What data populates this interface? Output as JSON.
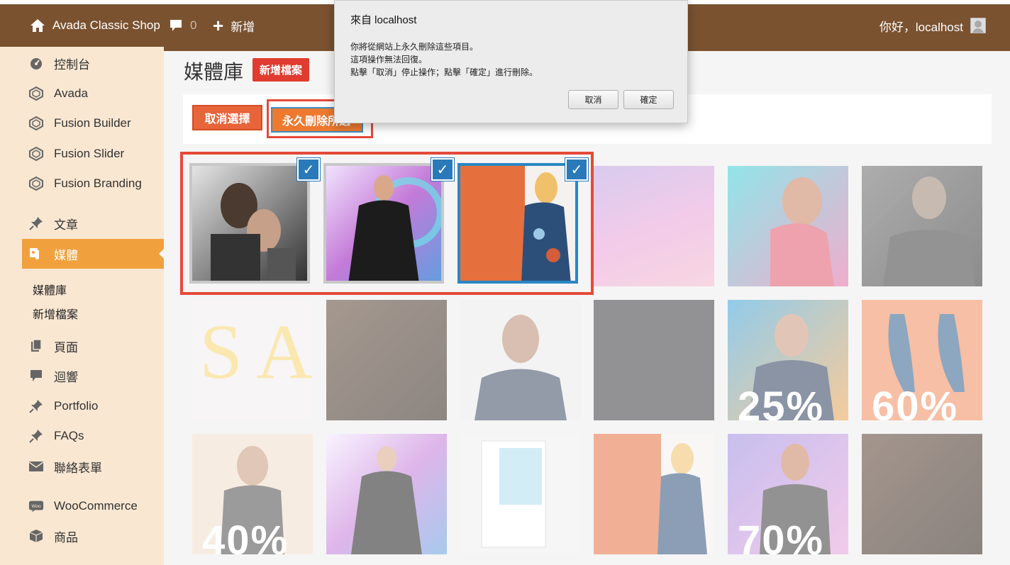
{
  "adminbar": {
    "site_name": "Avada Classic Shop",
    "comments_count": "0",
    "new_label": "新增",
    "greeting": "你好，localhost"
  },
  "sidebar": {
    "items": [
      {
        "label": "控制台",
        "icon": "dashboard-icon"
      },
      {
        "label": "Avada",
        "icon": "avada-icon"
      },
      {
        "label": "Fusion Builder",
        "icon": "fusion-builder-icon"
      },
      {
        "label": "Fusion Slider",
        "icon": "fusion-slider-icon"
      },
      {
        "label": "Fusion Branding",
        "icon": "fusion-branding-icon"
      },
      {
        "label": "文章",
        "icon": "pin-icon"
      },
      {
        "label": "媒體",
        "icon": "media-icon"
      },
      {
        "label": "頁面",
        "icon": "pages-icon"
      },
      {
        "label": "迴響",
        "icon": "comment-icon"
      },
      {
        "label": "Portfolio",
        "icon": "pin-icon"
      },
      {
        "label": "FAQs",
        "icon": "pin-icon"
      },
      {
        "label": "聯絡表單",
        "icon": "mail-icon"
      },
      {
        "label": "WooCommerce",
        "icon": "woocommerce-icon"
      },
      {
        "label": "商品",
        "icon": "box-icon"
      }
    ],
    "submenu": [
      "媒體庫",
      "新增檔案"
    ]
  },
  "main": {
    "title": "媒體庫",
    "add_new": "新增檔案",
    "cancel_selection": "取消選擇",
    "delete_permanently": "永久刪除所選"
  },
  "dialog": {
    "title": "來自 localhost",
    "lines": [
      "你將從網站上永久刪除這些項目。",
      "這項操作無法回復。",
      "點擊「取消」停止操作；點擊「確定」進行刪除。"
    ],
    "cancel": "取消",
    "ok": "確定"
  },
  "grid": {
    "tile_texts": {
      "r2c5": "25%",
      "r2c6": "60%",
      "r3c1": "40%",
      "r3c5": "70%"
    }
  },
  "colors": {
    "adminbar": "#7a5230",
    "sidebar": "#f9e7d2",
    "active_menu": "#f0a03c",
    "accent_red": "#e03c2f",
    "selection_blue": "#2a79b8"
  }
}
